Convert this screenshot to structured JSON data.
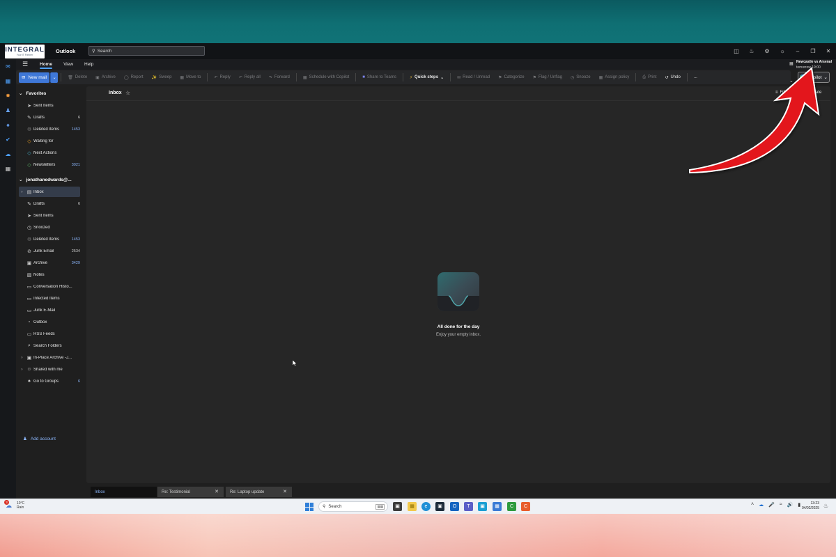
{
  "window": {
    "app_name": "Outlook",
    "logo": {
      "word": "INTEGRAL",
      "sub": "Your IT Partner"
    },
    "search_placeholder": "Search"
  },
  "ribbon_tabs": [
    "Home",
    "View",
    "Help"
  ],
  "ribbon": {
    "new_mail": "New mail",
    "buttons": [
      "Delete",
      "Archive",
      "Report",
      "Sweep",
      "Move to",
      "Reply",
      "Reply all",
      "Forward",
      "Schedule with Copilot",
      "Share to Teams",
      "Quick steps",
      "Read / Unread",
      "Categorize",
      "Flag / Unflag",
      "Snooze",
      "Assign policy",
      "Print",
      "Undo",
      "..."
    ],
    "copilot": "Copilot"
  },
  "event": {
    "title": "Newcastle vs Arsenal",
    "time": "tomorrow 19:00"
  },
  "favorites": {
    "header": "Favorites",
    "items": [
      {
        "label": "Sent Items",
        "count": "",
        "icon": "send-icon"
      },
      {
        "label": "Drafts",
        "count": "6",
        "icon": "pencil-icon"
      },
      {
        "label": "Deleted Items",
        "count": "1453",
        "icon": "trash-icon"
      },
      {
        "label": "Waiting for",
        "count": "",
        "icon": "tag-icon",
        "color": "#f5a623"
      },
      {
        "label": "Next Actions",
        "count": "",
        "icon": "tag-icon",
        "color": "#46b5d1"
      },
      {
        "label": "Newsletters",
        "count": "3021",
        "icon": "tag-icon",
        "color": "#5fbf6b"
      }
    ]
  },
  "account": {
    "header": "jonathanedwards@...",
    "items": [
      {
        "label": "Inbox",
        "count": "",
        "icon": "inbox-icon"
      },
      {
        "label": "Drafts",
        "count": "6",
        "icon": "pencil-icon"
      },
      {
        "label": "Sent Items",
        "count": "",
        "icon": "send-icon"
      },
      {
        "label": "Snoozed",
        "count": "",
        "icon": "clock-icon"
      },
      {
        "label": "Deleted Items",
        "count": "1453",
        "icon": "trash-icon"
      },
      {
        "label": "Junk Email",
        "count": "2534",
        "icon": "junk-icon"
      },
      {
        "label": "Archive",
        "count": "3429",
        "icon": "archive-icon"
      },
      {
        "label": "Notes",
        "count": "",
        "icon": "note-icon"
      },
      {
        "label": "Conversation Histo...",
        "count": "",
        "icon": "folder-icon"
      },
      {
        "label": "Infected Items",
        "count": "",
        "icon": "folder-icon"
      },
      {
        "label": "Junk E-Mail",
        "count": "",
        "icon": "folder-icon"
      },
      {
        "label": "Outbox",
        "count": "",
        "icon": "outbox-icon"
      },
      {
        "label": "RSS Feeds",
        "count": "",
        "icon": "folder-icon"
      },
      {
        "label": "Search Folders",
        "count": "",
        "icon": "search-folder-icon"
      },
      {
        "label": "In-Place Archive -J...",
        "count": "",
        "icon": "archive-icon"
      },
      {
        "label": "Shared with me",
        "count": "",
        "icon": "people-icon"
      },
      {
        "label": "Go to Groups",
        "count": "6",
        "icon": "groups-icon"
      }
    ],
    "add_account": "Add account"
  },
  "main": {
    "title": "Inbox",
    "filter": "Filter",
    "sort": "By Date",
    "empty_title": "All done for the day",
    "empty_sub": "Enjoy your empty inbox."
  },
  "open_tabs": [
    {
      "label": "Inbox",
      "closable": false
    },
    {
      "label": "Re: Testimonial",
      "closable": true
    },
    {
      "label": "Re: Laptop update",
      "closable": true
    }
  ],
  "taskbar": {
    "weather_temp": "10°C",
    "weather_desc": "Rain",
    "weather_badge": "3",
    "search_placeholder": "Search",
    "time": "13:23",
    "date": "04/02/2025"
  },
  "colors": {
    "accent": "#3f78d8",
    "highlight_arrow": "#e3171f"
  }
}
